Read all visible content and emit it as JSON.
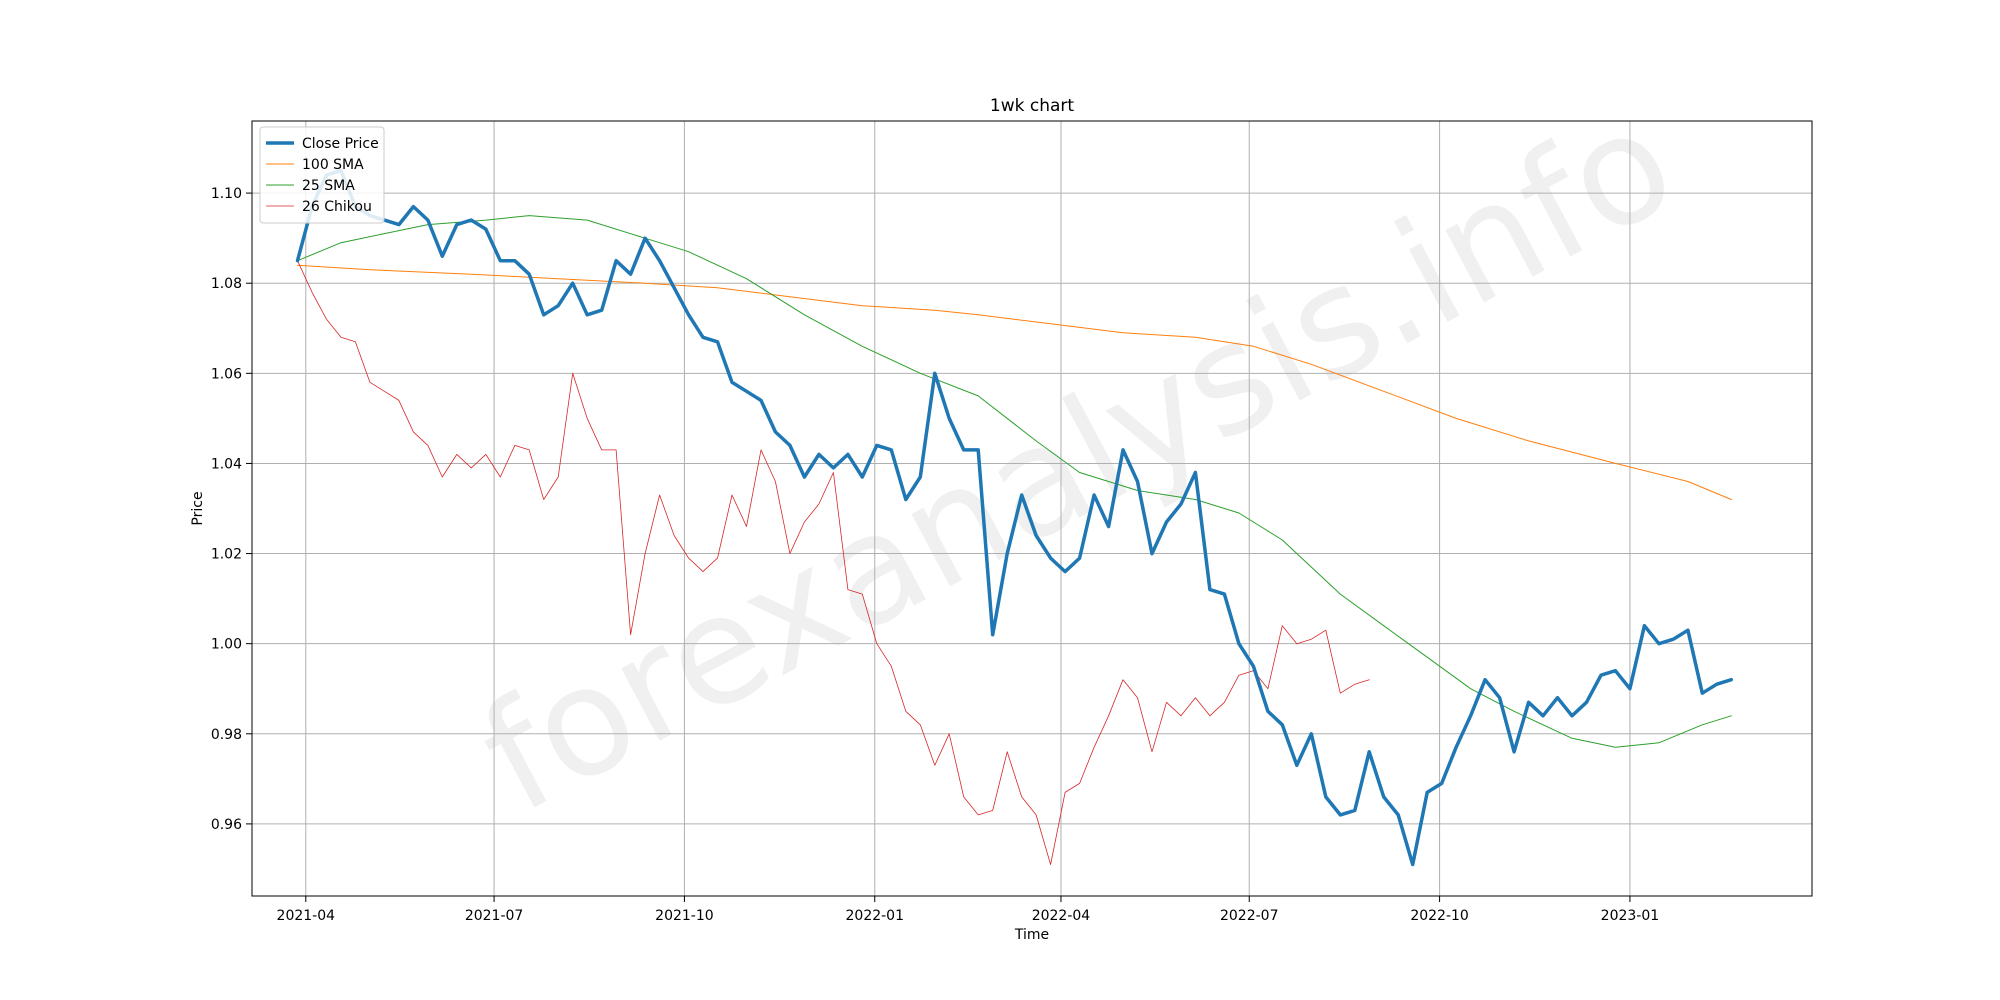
{
  "watermark": "forexanalysis.info",
  "chart_data": {
    "type": "line",
    "title": "1wk chart",
    "xlabel": "Time",
    "ylabel": "Price",
    "x_ticks": [
      "2021-04",
      "2021-07",
      "2021-10",
      "2022-01",
      "2022-04",
      "2022-07",
      "2022-10",
      "2023-01"
    ],
    "y_ticks": [
      "0.96",
      "0.98",
      "1.00",
      "1.02",
      "1.04",
      "1.06",
      "1.08",
      "1.10"
    ],
    "ylim": [
      0.944,
      1.116
    ],
    "xlim": [
      "2021-03-06",
      "2023-03-30"
    ],
    "grid": true,
    "legend_position": "top-left",
    "series": [
      {
        "name": "Close Price",
        "color": "#1f77b4",
        "width": 3.5,
        "points": [
          [
            "2021-03-28",
            1.085
          ],
          [
            "2021-04-04",
            1.097
          ],
          [
            "2021-04-11",
            1.104
          ],
          [
            "2021-04-18",
            1.105
          ],
          [
            "2021-04-25",
            1.097
          ],
          [
            "2021-05-02",
            1.095
          ],
          [
            "2021-05-09",
            1.094
          ],
          [
            "2021-05-16",
            1.093
          ],
          [
            "2021-05-23",
            1.097
          ],
          [
            "2021-05-30",
            1.094
          ],
          [
            "2021-06-06",
            1.086
          ],
          [
            "2021-06-13",
            1.093
          ],
          [
            "2021-06-20",
            1.094
          ],
          [
            "2021-06-27",
            1.092
          ],
          [
            "2021-07-04",
            1.085
          ],
          [
            "2021-07-11",
            1.085
          ],
          [
            "2021-07-18",
            1.082
          ],
          [
            "2021-07-25",
            1.073
          ],
          [
            "2021-08-01",
            1.075
          ],
          [
            "2021-08-08",
            1.08
          ],
          [
            "2021-08-15",
            1.073
          ],
          [
            "2021-08-22",
            1.074
          ],
          [
            "2021-08-29",
            1.085
          ],
          [
            "2021-09-05",
            1.082
          ],
          [
            "2021-09-12",
            1.09
          ],
          [
            "2021-09-19",
            1.085
          ],
          [
            "2021-09-26",
            1.079
          ],
          [
            "2021-10-03",
            1.073
          ],
          [
            "2021-10-10",
            1.068
          ],
          [
            "2021-10-17",
            1.067
          ],
          [
            "2021-10-24",
            1.058
          ],
          [
            "2021-10-31",
            1.056
          ],
          [
            "2021-11-07",
            1.054
          ],
          [
            "2021-11-14",
            1.047
          ],
          [
            "2021-11-21",
            1.044
          ],
          [
            "2021-11-28",
            1.037
          ],
          [
            "2021-12-05",
            1.042
          ],
          [
            "2021-12-12",
            1.039
          ],
          [
            "2021-12-19",
            1.042
          ],
          [
            "2021-12-26",
            1.037
          ],
          [
            "2022-01-02",
            1.044
          ],
          [
            "2022-01-09",
            1.043
          ],
          [
            "2022-01-16",
            1.032
          ],
          [
            "2022-01-23",
            1.037
          ],
          [
            "2022-01-30",
            1.06
          ],
          [
            "2022-02-06",
            1.05
          ],
          [
            "2022-02-13",
            1.043
          ],
          [
            "2022-02-20",
            1.043
          ],
          [
            "2022-02-27",
            1.002
          ],
          [
            "2022-03-06",
            1.02
          ],
          [
            "2022-03-13",
            1.033
          ],
          [
            "2022-03-20",
            1.024
          ],
          [
            "2022-03-27",
            1.019
          ],
          [
            "2022-04-03",
            1.016
          ],
          [
            "2022-04-10",
            1.019
          ],
          [
            "2022-04-17",
            1.033
          ],
          [
            "2022-04-24",
            1.026
          ],
          [
            "2022-05-01",
            1.043
          ],
          [
            "2022-05-08",
            1.036
          ],
          [
            "2022-05-15",
            1.02
          ],
          [
            "2022-05-22",
            1.027
          ],
          [
            "2022-05-29",
            1.031
          ],
          [
            "2022-06-05",
            1.038
          ],
          [
            "2022-06-12",
            1.012
          ],
          [
            "2022-06-19",
            1.011
          ],
          [
            "2022-06-26",
            1.0
          ],
          [
            "2022-07-03",
            0.995
          ],
          [
            "2022-07-10",
            0.985
          ],
          [
            "2022-07-17",
            0.982
          ],
          [
            "2022-07-24",
            0.973
          ],
          [
            "2022-07-31",
            0.98
          ],
          [
            "2022-08-07",
            0.966
          ],
          [
            "2022-08-14",
            0.962
          ],
          [
            "2022-08-21",
            0.963
          ],
          [
            "2022-08-28",
            0.976
          ],
          [
            "2022-09-04",
            0.966
          ],
          [
            "2022-09-11",
            0.962
          ],
          [
            "2022-09-18",
            0.951
          ],
          [
            "2022-09-25",
            0.967
          ],
          [
            "2022-10-02",
            0.969
          ],
          [
            "2022-10-09",
            0.977
          ],
          [
            "2022-10-16",
            0.984
          ],
          [
            "2022-10-23",
            0.992
          ],
          [
            "2022-10-30",
            0.988
          ],
          [
            "2022-11-06",
            0.976
          ],
          [
            "2022-11-13",
            0.987
          ],
          [
            "2022-11-20",
            0.984
          ],
          [
            "2022-11-27",
            0.988
          ],
          [
            "2022-12-04",
            0.984
          ],
          [
            "2022-12-11",
            0.987
          ],
          [
            "2022-12-18",
            0.993
          ],
          [
            "2022-12-25",
            0.994
          ],
          [
            "2023-01-01",
            0.99
          ],
          [
            "2023-01-08",
            1.004
          ],
          [
            "2023-01-15",
            1.0
          ],
          [
            "2023-01-22",
            1.001
          ],
          [
            "2023-01-29",
            1.003
          ],
          [
            "2023-02-05",
            0.989
          ],
          [
            "2023-02-12",
            0.991
          ],
          [
            "2023-02-19",
            0.992
          ]
        ]
      },
      {
        "name": "100 SMA",
        "color": "#ff7f0e",
        "width": 1,
        "points": [
          [
            "2021-03-28",
            1.084
          ],
          [
            "2021-05-02",
            1.083
          ],
          [
            "2021-06-20",
            1.082
          ],
          [
            "2021-08-01",
            1.081
          ],
          [
            "2021-09-12",
            1.08
          ],
          [
            "2021-10-17",
            1.079
          ],
          [
            "2021-11-21",
            1.077
          ],
          [
            "2021-12-26",
            1.075
          ],
          [
            "2022-01-30",
            1.074
          ],
          [
            "2022-02-20",
            1.073
          ],
          [
            "2022-03-27",
            1.071
          ],
          [
            "2022-05-01",
            1.069
          ],
          [
            "2022-06-05",
            1.068
          ],
          [
            "2022-07-03",
            1.066
          ],
          [
            "2022-07-31",
            1.062
          ],
          [
            "2022-09-04",
            1.056
          ],
          [
            "2022-10-09",
            1.05
          ],
          [
            "2022-11-13",
            1.045
          ],
          [
            "2022-12-25",
            1.04
          ],
          [
            "2023-01-29",
            1.036
          ],
          [
            "2023-02-19",
            1.032
          ]
        ]
      },
      {
        "name": "25 SMA",
        "color": "#2ca02c",
        "width": 1,
        "points": [
          [
            "2021-03-28",
            1.085
          ],
          [
            "2021-04-18",
            1.089
          ],
          [
            "2021-05-09",
            1.091
          ],
          [
            "2021-05-30",
            1.093
          ],
          [
            "2021-06-27",
            1.094
          ],
          [
            "2021-07-18",
            1.095
          ],
          [
            "2021-08-15",
            1.094
          ],
          [
            "2021-09-12",
            1.09
          ],
          [
            "2021-10-03",
            1.087
          ],
          [
            "2021-10-31",
            1.081
          ],
          [
            "2021-11-28",
            1.073
          ],
          [
            "2021-12-26",
            1.066
          ],
          [
            "2022-01-23",
            1.06
          ],
          [
            "2022-02-20",
            1.055
          ],
          [
            "2022-03-20",
            1.045
          ],
          [
            "2022-04-10",
            1.038
          ],
          [
            "2022-05-08",
            1.034
          ],
          [
            "2022-06-05",
            1.032
          ],
          [
            "2022-06-26",
            1.029
          ],
          [
            "2022-07-17",
            1.023
          ],
          [
            "2022-08-14",
            1.011
          ],
          [
            "2022-09-04",
            1.004
          ],
          [
            "2022-09-25",
            0.997
          ],
          [
            "2022-10-16",
            0.99
          ],
          [
            "2022-11-06",
            0.985
          ],
          [
            "2022-12-04",
            0.979
          ],
          [
            "2022-12-25",
            0.977
          ],
          [
            "2023-01-15",
            0.978
          ],
          [
            "2023-02-05",
            0.982
          ],
          [
            "2023-02-19",
            0.984
          ]
        ]
      },
      {
        "name": "26 Chikou",
        "color": "#d62728",
        "width": 0.8,
        "points": [
          [
            "2021-03-28",
            1.085
          ],
          [
            "2021-04-04",
            1.078
          ],
          [
            "2021-04-11",
            1.072
          ],
          [
            "2021-04-18",
            1.068
          ],
          [
            "2021-04-25",
            1.067
          ],
          [
            "2021-05-02",
            1.058
          ],
          [
            "2021-05-09",
            1.056
          ],
          [
            "2021-05-16",
            1.054
          ],
          [
            "2021-05-23",
            1.047
          ],
          [
            "2021-05-30",
            1.044
          ],
          [
            "2021-06-06",
            1.037
          ],
          [
            "2021-06-13",
            1.042
          ],
          [
            "2021-06-20",
            1.039
          ],
          [
            "2021-06-27",
            1.042
          ],
          [
            "2021-07-04",
            1.037
          ],
          [
            "2021-07-11",
            1.044
          ],
          [
            "2021-07-18",
            1.043
          ],
          [
            "2021-07-25",
            1.032
          ],
          [
            "2021-08-01",
            1.037
          ],
          [
            "2021-08-08",
            1.06
          ],
          [
            "2021-08-15",
            1.05
          ],
          [
            "2021-08-22",
            1.043
          ],
          [
            "2021-08-29",
            1.043
          ],
          [
            "2021-09-05",
            1.002
          ],
          [
            "2021-09-12",
            1.02
          ],
          [
            "2021-09-19",
            1.033
          ],
          [
            "2021-09-26",
            1.024
          ],
          [
            "2021-10-03",
            1.019
          ],
          [
            "2021-10-10",
            1.016
          ],
          [
            "2021-10-17",
            1.019
          ],
          [
            "2021-10-24",
            1.033
          ],
          [
            "2021-10-31",
            1.026
          ],
          [
            "2021-11-07",
            1.043
          ],
          [
            "2021-11-14",
            1.036
          ],
          [
            "2021-11-21",
            1.02
          ],
          [
            "2021-11-28",
            1.027
          ],
          [
            "2021-12-05",
            1.031
          ],
          [
            "2021-12-12",
            1.038
          ],
          [
            "2021-12-19",
            1.012
          ],
          [
            "2021-12-26",
            1.011
          ],
          [
            "2022-01-02",
            1.0
          ],
          [
            "2022-01-09",
            0.995
          ],
          [
            "2022-01-16",
            0.985
          ],
          [
            "2022-01-23",
            0.982
          ],
          [
            "2022-01-30",
            0.973
          ],
          [
            "2022-02-06",
            0.98
          ],
          [
            "2022-02-13",
            0.966
          ],
          [
            "2022-02-20",
            0.962
          ],
          [
            "2022-02-27",
            0.963
          ],
          [
            "2022-03-06",
            0.976
          ],
          [
            "2022-03-13",
            0.966
          ],
          [
            "2022-03-20",
            0.962
          ],
          [
            "2022-03-27",
            0.951
          ],
          [
            "2022-04-03",
            0.967
          ],
          [
            "2022-04-10",
            0.969
          ],
          [
            "2022-04-17",
            0.977
          ],
          [
            "2022-04-24",
            0.984
          ],
          [
            "2022-05-01",
            0.992
          ],
          [
            "2022-05-08",
            0.988
          ],
          [
            "2022-05-15",
            0.976
          ],
          [
            "2022-05-22",
            0.987
          ],
          [
            "2022-05-29",
            0.984
          ],
          [
            "2022-06-05",
            0.988
          ],
          [
            "2022-06-12",
            0.984
          ],
          [
            "2022-06-19",
            0.987
          ],
          [
            "2022-06-26",
            0.993
          ],
          [
            "2022-07-03",
            0.994
          ],
          [
            "2022-07-10",
            0.99
          ],
          [
            "2022-07-17",
            1.004
          ],
          [
            "2022-07-24",
            1.0
          ],
          [
            "2022-07-31",
            1.001
          ],
          [
            "2022-08-07",
            1.003
          ],
          [
            "2022-08-14",
            0.989
          ],
          [
            "2022-08-21",
            0.991
          ],
          [
            "2022-08-28",
            0.992
          ]
        ]
      }
    ]
  }
}
